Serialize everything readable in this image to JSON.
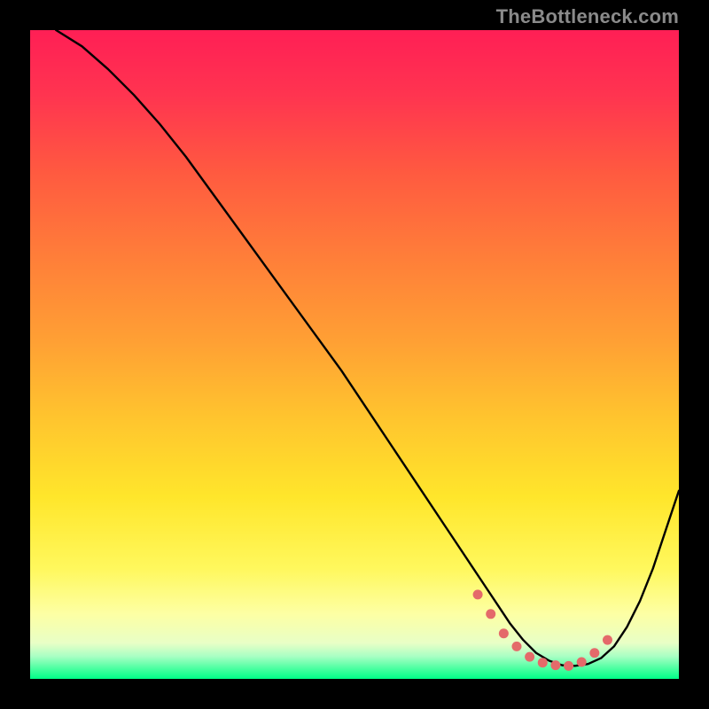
{
  "watermark": "TheBottleneck.com",
  "colors": {
    "background": "#000000",
    "curve": "#000000",
    "dots": "#e46a6a",
    "dots_stroke": "#e46a6a",
    "gradient_stops": [
      {
        "offset": 0.0,
        "color": "#ff1f55"
      },
      {
        "offset": 0.1,
        "color": "#ff3450"
      },
      {
        "offset": 0.22,
        "color": "#ff5a40"
      },
      {
        "offset": 0.35,
        "color": "#ff7e39"
      },
      {
        "offset": 0.48,
        "color": "#ffa034"
      },
      {
        "offset": 0.6,
        "color": "#ffc52e"
      },
      {
        "offset": 0.72,
        "color": "#ffe62b"
      },
      {
        "offset": 0.83,
        "color": "#fff85d"
      },
      {
        "offset": 0.9,
        "color": "#fdffa4"
      },
      {
        "offset": 0.945,
        "color": "#e8ffc6"
      },
      {
        "offset": 0.965,
        "color": "#aaffc4"
      },
      {
        "offset": 0.985,
        "color": "#46ff9f"
      },
      {
        "offset": 1.0,
        "color": "#00ff88"
      }
    ]
  },
  "chart_data": {
    "type": "line",
    "title": "",
    "xlabel": "",
    "ylabel": "",
    "xlim": [
      0,
      100
    ],
    "ylim": [
      0,
      100
    ],
    "grid": false,
    "legend": false,
    "series": [
      {
        "name": "bottleneck-curve",
        "x": [
          4,
          8,
          12,
          16,
          20,
          24,
          28,
          32,
          36,
          40,
          44,
          48,
          52,
          56,
          60,
          64,
          68,
          70,
          72,
          74,
          76,
          78,
          80,
          82,
          84,
          86,
          88,
          90,
          92,
          94,
          96,
          98,
          100
        ],
        "y": [
          100,
          97.5,
          94,
          90,
          85.5,
          80.5,
          75,
          69.5,
          64,
          58.5,
          53,
          47.5,
          41.5,
          35.5,
          29.5,
          23.5,
          17.5,
          14.5,
          11.5,
          8.5,
          6,
          4,
          2.8,
          2.1,
          2,
          2.3,
          3.2,
          5,
          8,
          12,
          17,
          23,
          29
        ]
      }
    ],
    "markers": {
      "name": "trough-dots",
      "x": [
        69,
        71,
        73,
        75,
        77,
        79,
        81,
        83,
        85,
        87,
        89
      ],
      "y": [
        13.0,
        10.0,
        7.0,
        5.0,
        3.4,
        2.5,
        2.1,
        2.0,
        2.6,
        4.0,
        6.0
      ]
    }
  }
}
